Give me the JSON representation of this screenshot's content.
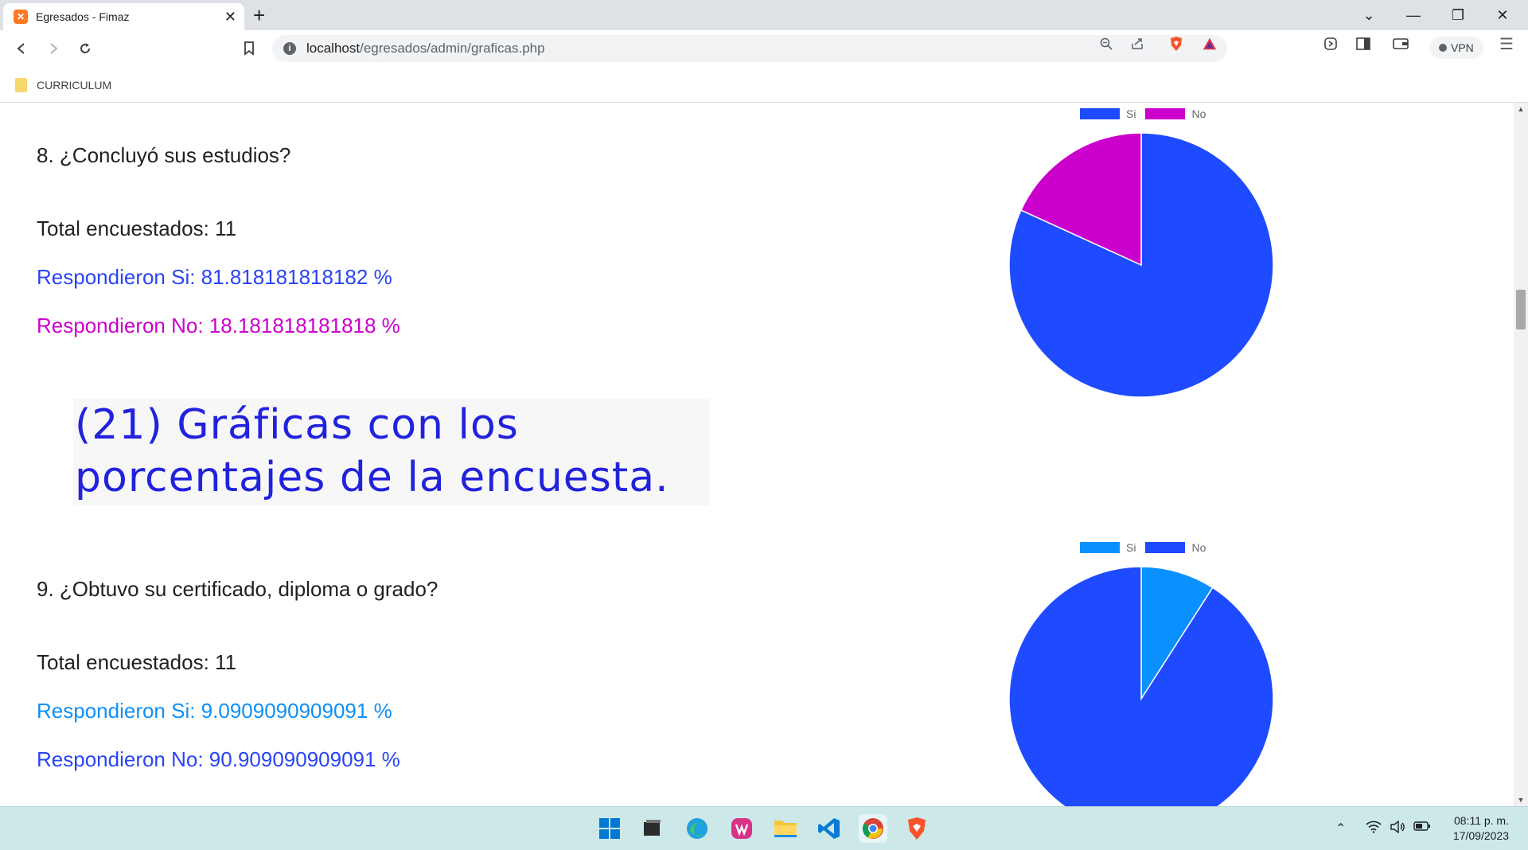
{
  "browser": {
    "tab_title": "Egresados - Fimaz",
    "url_host": "localhost",
    "url_path": "/egresados/admin/graficas.php",
    "vpn_label": "VPN",
    "bookmark_folder": "CURRICULUM"
  },
  "questions": [
    {
      "question": "8. ¿Concluyó sus estudios?",
      "total": "Total encuestados: 11",
      "si_text": "Respondieron Si: 81.818181818182 %",
      "no_text": "Respondieron No: 18.181818181818 %",
      "si_color": "#2a44f5",
      "no_color": "#cc00cc",
      "legend": [
        "Si",
        "No"
      ]
    },
    {
      "question": "9. ¿Obtuvo su certificado, diploma o grado?",
      "total": "Total encuestados: 11",
      "si_text": "Respondieron Si: 9.0909090909091 %",
      "no_text": "Respondieron No: 90.909090909091 %",
      "si_color": "#0f8ff5",
      "no_color": "#2a44f5",
      "legend": [
        "Si",
        "No"
      ]
    }
  ],
  "caption": "(21) Gráficas con los porcentajes de la encuesta.",
  "chart_data": [
    {
      "type": "pie",
      "categories": [
        "Si",
        "No"
      ],
      "values": [
        81.818181818182,
        18.181818181818
      ],
      "colors": [
        "#1e4bff",
        "#cc00cc"
      ],
      "legend_position": "top"
    },
    {
      "type": "pie",
      "categories": [
        "Si",
        "No"
      ],
      "values": [
        9.0909090909091,
        90.909090909091
      ],
      "colors": [
        "#0a90ff",
        "#1e4bff"
      ],
      "legend_position": "top"
    }
  ],
  "taskbar": {
    "time": "08:11 p. m.",
    "date": "17/09/2023",
    "apps": [
      "windows-start",
      "app",
      "edge",
      "wps-office",
      "file-explorer",
      "vscode",
      "chrome",
      "brave"
    ]
  }
}
